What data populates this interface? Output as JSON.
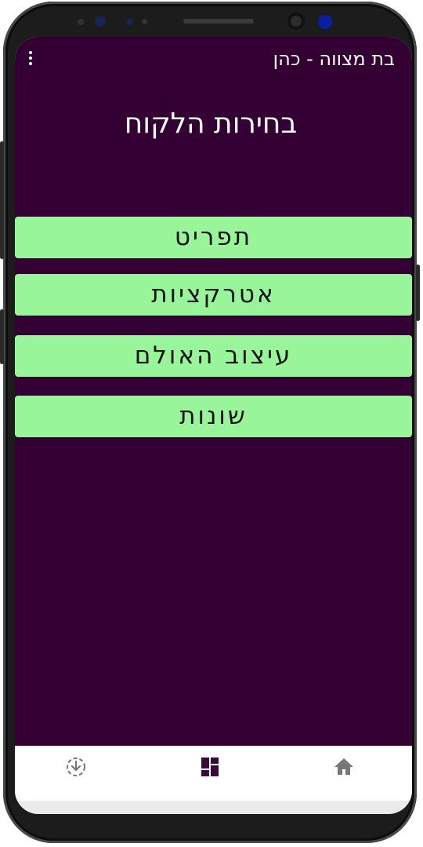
{
  "appbar": {
    "title": "בת מצווה - כהן",
    "menu_icon": "more-vert-icon"
  },
  "page": {
    "title": "בחירות הלקוח"
  },
  "options": [
    {
      "label": "תפריט"
    },
    {
      "label": "אטרקציות"
    },
    {
      "label": "עיצוב האולם"
    },
    {
      "label": "שונות"
    }
  ],
  "bottom_nav": {
    "items": [
      {
        "icon": "download-circle-icon",
        "active": false
      },
      {
        "icon": "dashboard-icon",
        "active": true
      },
      {
        "icon": "home-icon",
        "active": false
      }
    ]
  },
  "colors": {
    "background": "#340034",
    "button": "#99f599",
    "nav_active": "#3a0a3a",
    "nav_inactive": "#777777"
  }
}
